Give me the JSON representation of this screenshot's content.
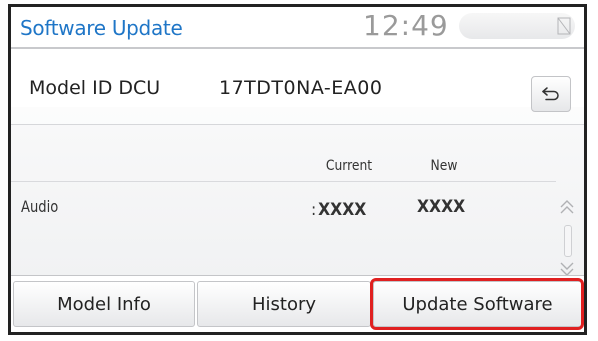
{
  "header": {
    "title": "Software Update",
    "clock": "12:49",
    "status_icon": "no-signal-icon"
  },
  "model": {
    "label": "Model ID DCU",
    "value": "17TDT0NA-EA00",
    "back_icon": "back-arrow-icon"
  },
  "versions": {
    "columns": {
      "current": "Current",
      "new": "New"
    },
    "rows": [
      {
        "name": "Audio",
        "separator": ":",
        "current": "XXXX",
        "new": "XXXX"
      }
    ]
  },
  "scroll": {
    "up_icon": "double-chevron-up-icon",
    "down_icon": "double-chevron-down-icon"
  },
  "buttons": {
    "model_info": "Model Info",
    "history": "History",
    "update_software": "Update Software"
  },
  "colors": {
    "title_blue": "#1f76c7",
    "highlight_red": "#e02020",
    "clock_gray": "#9a9a9a"
  }
}
